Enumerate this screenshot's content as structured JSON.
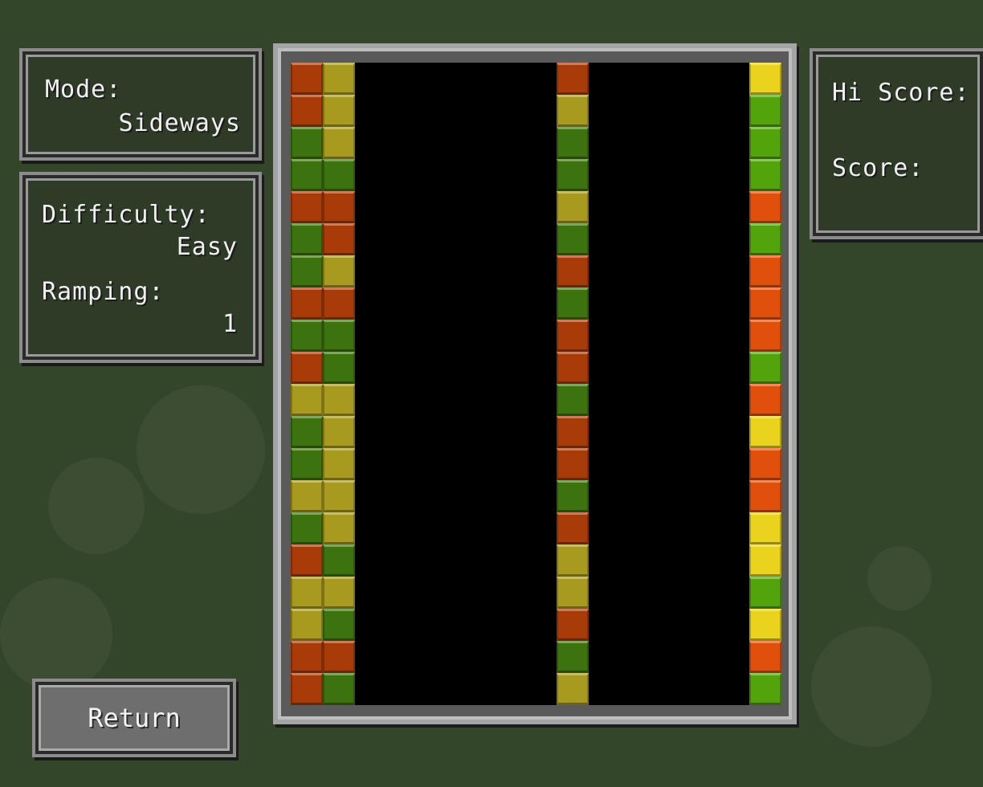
{
  "info": {
    "mode_label": "Mode:",
    "mode_value": "Sideways",
    "difficulty_label": "Difficulty:",
    "difficulty_value": "Easy",
    "ramping_label": "Ramping:",
    "ramping_value": "1"
  },
  "scores": {
    "hi_score_label": "Hi Score:",
    "score_label": "Score:"
  },
  "return_button": "Return",
  "colors": {
    "R": "#a83b08",
    "G": "#3d730f",
    "Y": "#a89a1e",
    "O": "#e0500a",
    "L": "#52a30c",
    "B": "#ead31c"
  },
  "board": {
    "rows": 20,
    "columns": [
      {
        "col_index": 0,
        "cells": "RRGGRGGRGRYGGYGRYYRR"
      },
      {
        "col_index": 1,
        "cells": "YYYGRRYRGGYYYYYGYGRG"
      },
      {
        "col_index": 8,
        "cells": "RYGGYGRGRRGRRGRYYRGY"
      },
      {
        "col_index": 14,
        "cells": "BLLLOLOOOLOBOOBBLBOL"
      }
    ]
  }
}
